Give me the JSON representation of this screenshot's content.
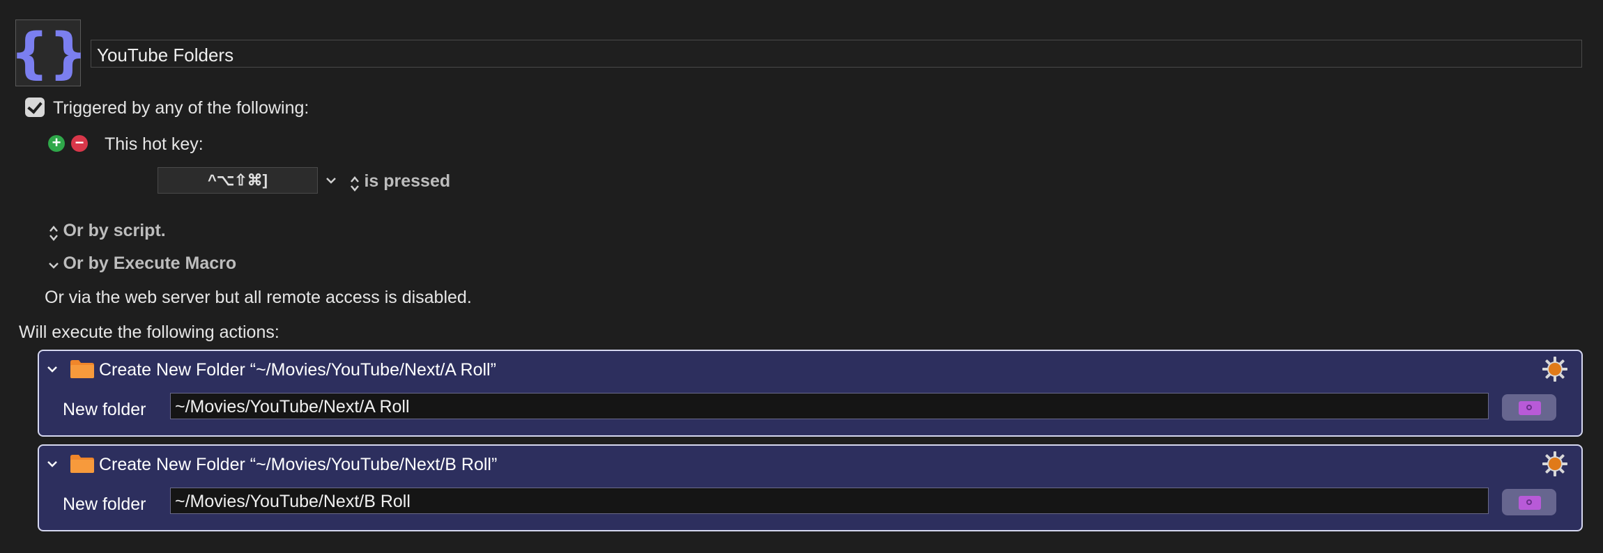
{
  "macro": {
    "icon": "curly-braces-icon",
    "name": "YouTube Folders"
  },
  "trigger": {
    "enabled": true,
    "header": "Triggered by any of the following:",
    "hotkey_label": "This hot key:",
    "hotkey_value": "^⌥⇧⌘]",
    "hotkey_condition": "is pressed",
    "or_by_script": "Or by script.",
    "or_by_execute_macro": "Or by Execute Macro",
    "web_server_note": "Or via the web server but all remote access is disabled."
  },
  "actions_header": "Will execute the following actions:",
  "actions": [
    {
      "title": "Create New Folder “~/Movies/YouTube/Next/A Roll”",
      "field_label": "New folder",
      "field_value": "~/Movies/YouTube/Next/A Roll"
    },
    {
      "title": "Create New Folder “~/Movies/YouTube/Next/B Roll”",
      "field_label": "New folder",
      "field_value": "~/Movies/YouTube/Next/B Roll"
    }
  ],
  "colors": {
    "background": "#1e1e1e",
    "action_background": "#2d2f5e",
    "icon_accent": "#7b7ff0",
    "folder_orange": "#f0862a",
    "gear_orange": "#e07a18"
  }
}
